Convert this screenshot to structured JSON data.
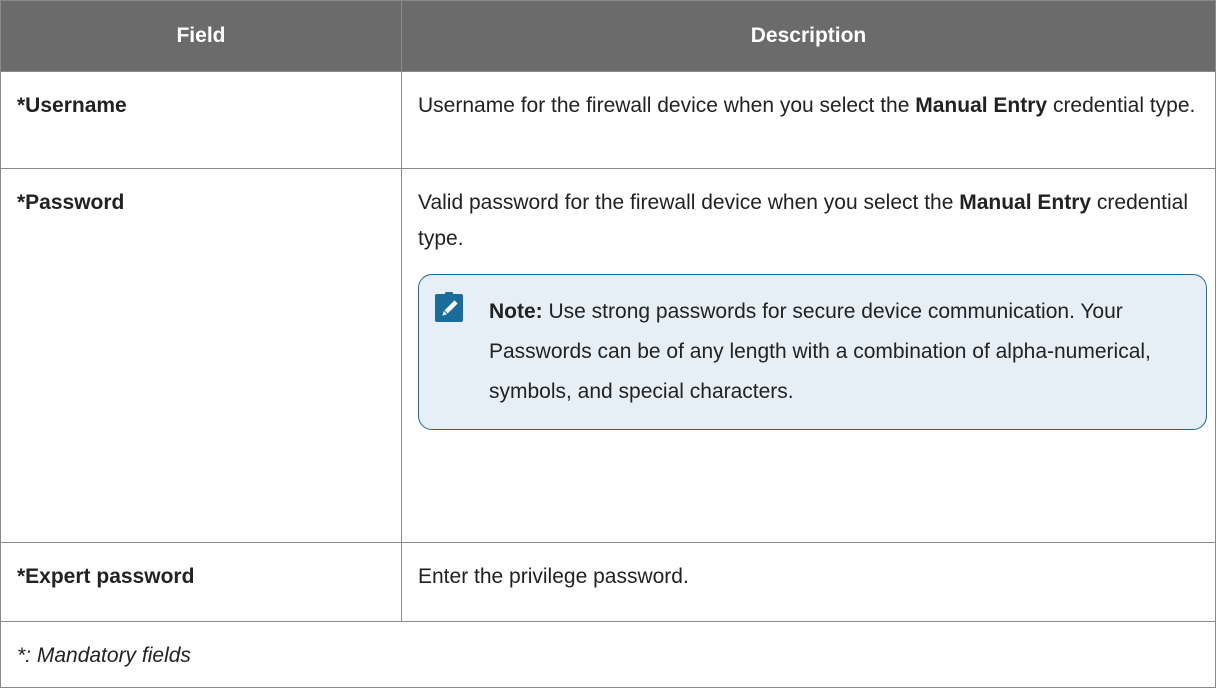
{
  "table": {
    "headers": [
      "Field",
      "Description"
    ],
    "rows": [
      {
        "field": "*Username",
        "desc_before": "Username for the firewall device when you select the ",
        "desc_bold": "Manual Entry",
        "desc_after": " credential type."
      },
      {
        "field": "*Password",
        "desc_before": "Valid password for the firewall device when you select the ",
        "desc_bold": "Manual Entry",
        "desc_after": " credential type.",
        "note": {
          "icon": "pencil-note-icon",
          "label": "Note:",
          "text": " Use strong passwords for secure device communication. Your Passwords can be of any length with a combination of alpha-numerical, symbols, and special characters."
        }
      },
      {
        "field": "*Expert password",
        "desc_before": "Enter the privilege password."
      }
    ],
    "footnote": "*: Mandatory fields"
  },
  "colors": {
    "header_bg": "#6b6b6b",
    "note_border": "#1d6a96",
    "note_bg": "#e6eff6",
    "icon": "#1a6d9b"
  }
}
